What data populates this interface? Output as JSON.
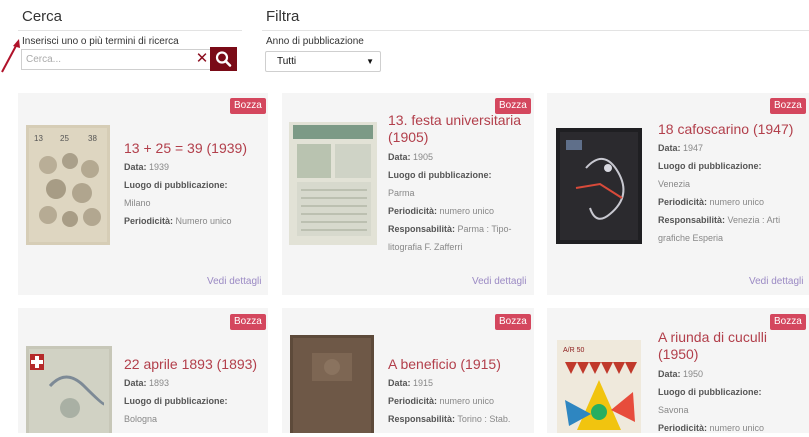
{
  "search": {
    "title": "Cerca",
    "label": "Inserisci uno o più termini di ricerca",
    "placeholder": "Cerca...",
    "clear_symbol": "✕",
    "button_icon": "search-icon"
  },
  "filter": {
    "title": "Filtra",
    "label": "Anno di pubblicazione",
    "selected": "Tutti"
  },
  "colors": {
    "accent": "#7a0b17",
    "badge": "#d4475e",
    "title": "#b23f4b",
    "link": "#9b8ac4"
  },
  "cards": [
    {
      "badge": "Bozza",
      "title": "13 + 25 = 39 (1939)",
      "data_label": "Data:",
      "data": "1939",
      "luogo_label": "Luogo di pubblicazione:",
      "luogo": "Milano",
      "periodicita_label": "Periodicità:",
      "periodicita": "Numero unico",
      "details": "Vedi dettagli"
    },
    {
      "badge": "Bozza",
      "title": "13. festa universitaria (1905)",
      "data_label": "Data:",
      "data": "1905",
      "luogo_label": "Luogo di pubblicazione:",
      "luogo": "Parma",
      "periodicita_label": "Periodicità:",
      "periodicita": "numero unico",
      "resp_label": "Responsabilità:",
      "resp": "Parma : Tipo-litografia F. Zafferri",
      "details": "Vedi dettagli"
    },
    {
      "badge": "Bozza",
      "title": "18 cafoscarino (1947)",
      "data_label": "Data:",
      "data": "1947",
      "luogo_label": "Luogo di pubblicazione:",
      "luogo": "Venezia",
      "periodicita_label": "Periodicità:",
      "periodicita": "numero unico",
      "resp_label": "Responsabilità:",
      "resp": "Venezia : Arti grafiche Esperia",
      "details": "Vedi dettagli"
    },
    {
      "badge": "Bozza",
      "title": "22 aprile 1893 (1893)",
      "data_label": "Data:",
      "data": "1893",
      "luogo_label": "Luogo di pubblicazione:",
      "luogo": "Bologna"
    },
    {
      "badge": "Bozza",
      "title": "A beneficio (1915)",
      "data_label": "Data:",
      "data": "1915",
      "periodicita_label": "Periodicità:",
      "periodicita": "numero unico",
      "resp_label": "Responsabilità:",
      "resp": "Torino : Stab."
    },
    {
      "badge": "Bozza",
      "title": "A riunda di cuculli (1950)",
      "data_label": "Data:",
      "data": "1950",
      "luogo_label": "Luogo di pubblicazione:",
      "luogo": "Savona",
      "periodicita_label": "Periodicità:",
      "periodicita": "numero unico"
    }
  ]
}
